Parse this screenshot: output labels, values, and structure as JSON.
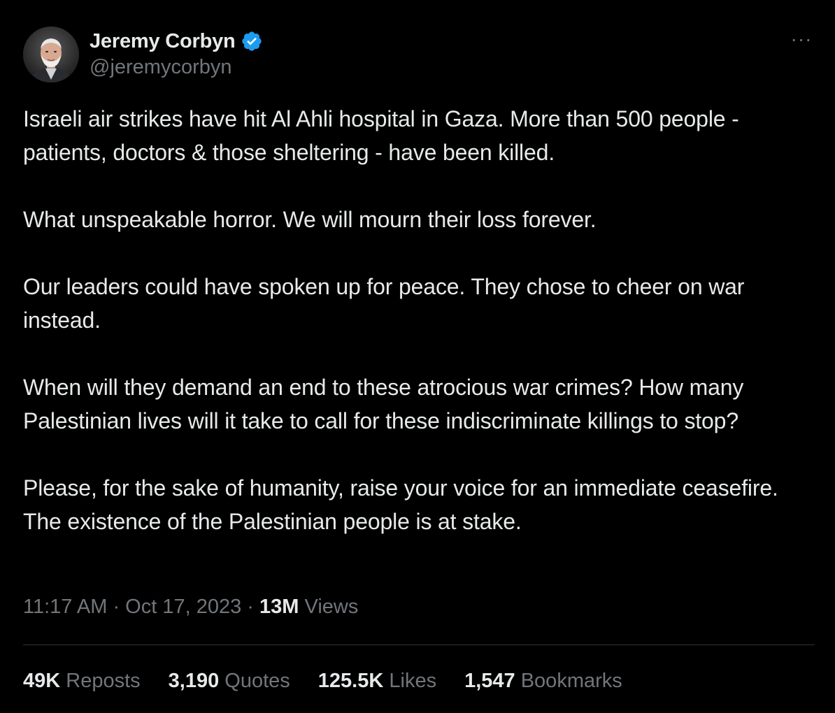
{
  "author": {
    "display_name": "Jeremy Corbyn",
    "handle": "@jeremycorbyn",
    "verified": true
  },
  "more_menu": "···",
  "tweet": {
    "paragraphs": [
      "Israeli air strikes have hit Al Ahli hospital in Gaza. More than 500 people - patients, doctors & those sheltering - have been killed.",
      "What unspeakable horror. We will mourn their loss forever.",
      "Our leaders could have spoken up for peace. They chose to cheer on war instead.",
      "When will they demand an end to these atrocious war crimes? How many Palestinian lives will it take to call for these indiscriminate killings to stop?",
      "Please, for the sake of humanity, raise your voice for an immediate ceasefire. The existence of the Palestinian people is at stake."
    ]
  },
  "meta": {
    "time": "11:17 AM",
    "sep1": " · ",
    "date": "Oct 17, 2023",
    "sep2": " · ",
    "views_count": "13M",
    "views_label": " Views"
  },
  "stats": [
    {
      "count": "49K",
      "label": " Reposts"
    },
    {
      "count": "3,190",
      "label": " Quotes"
    },
    {
      "count": "125.5K",
      "label": " Likes"
    },
    {
      "count": "1,547",
      "label": " Bookmarks"
    }
  ],
  "colors": {
    "background": "#000000",
    "text_primary": "#e7e9ea",
    "text_secondary": "#71767b",
    "verified_blue": "#1d9bf0",
    "divider": "#2f3336"
  },
  "icons": {
    "verified": "verified-badge-icon",
    "more": "more-horizontal-icon"
  }
}
